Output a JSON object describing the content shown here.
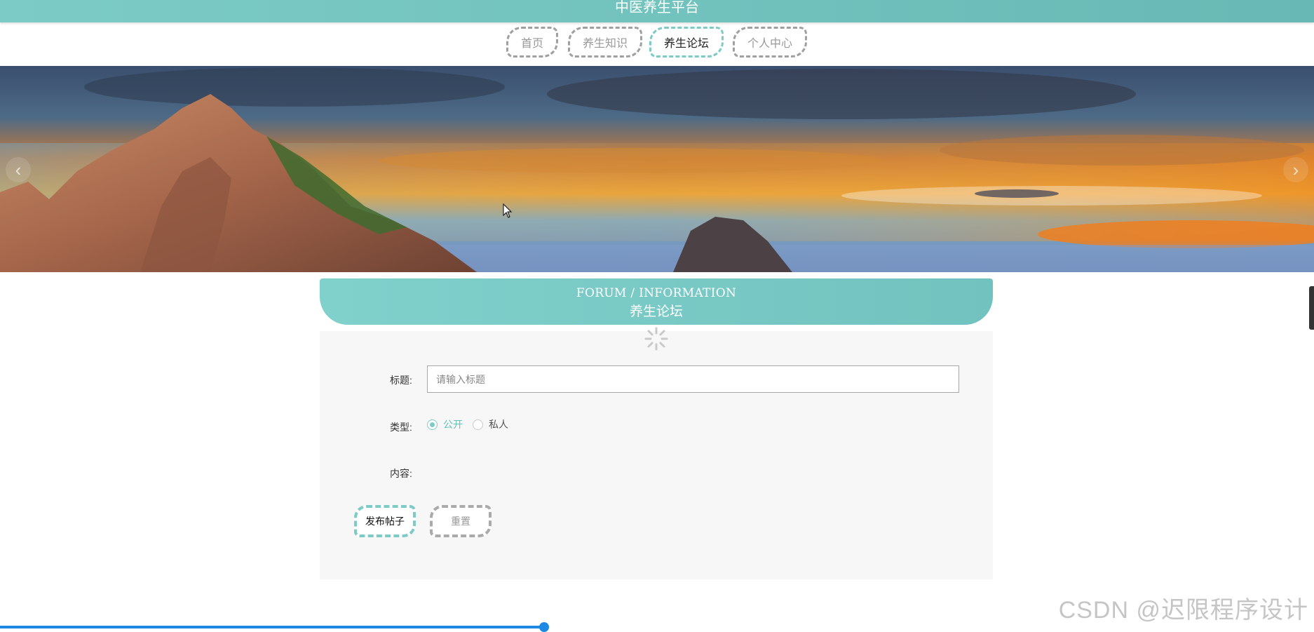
{
  "header": {
    "site_title": "中医养生平台"
  },
  "nav": {
    "tabs": [
      {
        "label": "首页",
        "active": false
      },
      {
        "label": "养生知识",
        "active": false
      },
      {
        "label": "养生论坛",
        "active": true
      },
      {
        "label": "个人中心",
        "active": false
      }
    ]
  },
  "banner": {
    "prev_arrow": "‹",
    "next_arrow": "›",
    "icons": {
      "prev": "chevron-left-icon",
      "next": "chevron-right-icon"
    }
  },
  "section": {
    "title_en": "FORUM / INFORMATION",
    "title_zh": "养生论坛"
  },
  "form": {
    "title_label": "标题:",
    "title_placeholder": "请输入标题",
    "title_value": "",
    "type_label": "类型:",
    "type_options": [
      {
        "label": "公开",
        "checked": true
      },
      {
        "label": "私人",
        "checked": false
      }
    ],
    "content_label": "内容:",
    "submit_label": "发布帖子",
    "reset_label": "重置"
  },
  "page_progress": 0.414,
  "watermark": "CSDN @迟限程序设计",
  "colors": {
    "accent": "#7ccbc7",
    "progress": "#1e88e5",
    "inactive_border": "#a0a0a0"
  }
}
